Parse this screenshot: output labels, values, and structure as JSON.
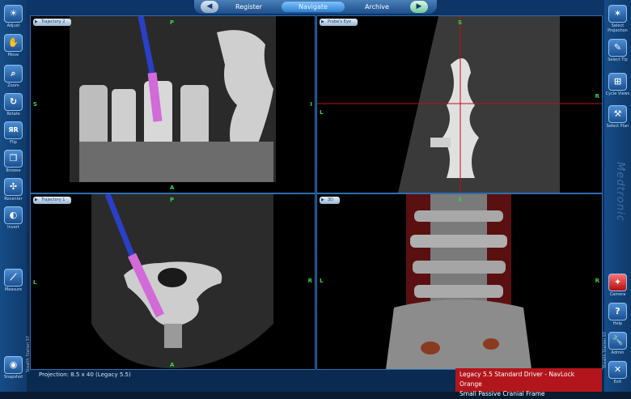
{
  "nav": {
    "tabs": [
      "Register",
      "Navigate",
      "Archive"
    ],
    "active": "Navigate"
  },
  "left_tools": [
    {
      "label": "Adjust",
      "icon": "sun-icon"
    },
    {
      "label": "Move",
      "icon": "hand-icon"
    },
    {
      "label": "Zoom",
      "icon": "magnifier-icon"
    },
    {
      "label": "Rotate",
      "icon": "rotate-icon"
    },
    {
      "label": "Flip",
      "icon": "flip-icon"
    },
    {
      "label": "Browse",
      "icon": "browse-icon"
    },
    {
      "label": "Recenter",
      "icon": "recenter-icon"
    },
    {
      "label": "Invert",
      "icon": "invert-icon"
    },
    {
      "label": "Measure",
      "icon": "ruler-icon"
    },
    {
      "label": "Snapshot",
      "icon": "camera-icon"
    }
  ],
  "right_tools": [
    {
      "label": "Select Projection",
      "icon": "projection-icon"
    },
    {
      "label": "Select Tip",
      "icon": "tip-icon"
    },
    {
      "label": "Cycle Views",
      "icon": "cycle-views-icon"
    },
    {
      "label": "Select Plan",
      "icon": "plan-icon"
    },
    {
      "label": "Camera",
      "icon": "camera-tracker-icon"
    },
    {
      "label": "Help",
      "icon": "help-icon"
    },
    {
      "label": "Admin",
      "icon": "wrench-icon"
    },
    {
      "label": "Exit",
      "icon": "close-icon"
    }
  ],
  "left_side_text": "Stealth Station S7",
  "right_side_text": "Stealth Station S7",
  "brand": "Medtronic",
  "viewports": [
    {
      "tab": "Trajectory 2",
      "orient": {
        "top": "P",
        "bottom": "A",
        "left": "S",
        "right": "I"
      }
    },
    {
      "tab": "Probe's Eye",
      "orient": {
        "top": "S",
        "bottom": "",
        "left": "L",
        "right": "R"
      }
    },
    {
      "tab": "Trajectory 1",
      "orient": {
        "top": "P",
        "bottom": "A",
        "left": "L",
        "right": "R"
      }
    },
    {
      "tab": "3D",
      "orient": {
        "top": "S",
        "bottom": "",
        "left": "L",
        "right": "R"
      }
    }
  ],
  "status": {
    "projection": "Projection: 8.5 x 40 (Legacy 5.5)"
  },
  "instrument": {
    "line1": "Legacy 5.5 Standard Driver - NavLock Orange",
    "line2": "Small Passive Cranial Frame"
  }
}
